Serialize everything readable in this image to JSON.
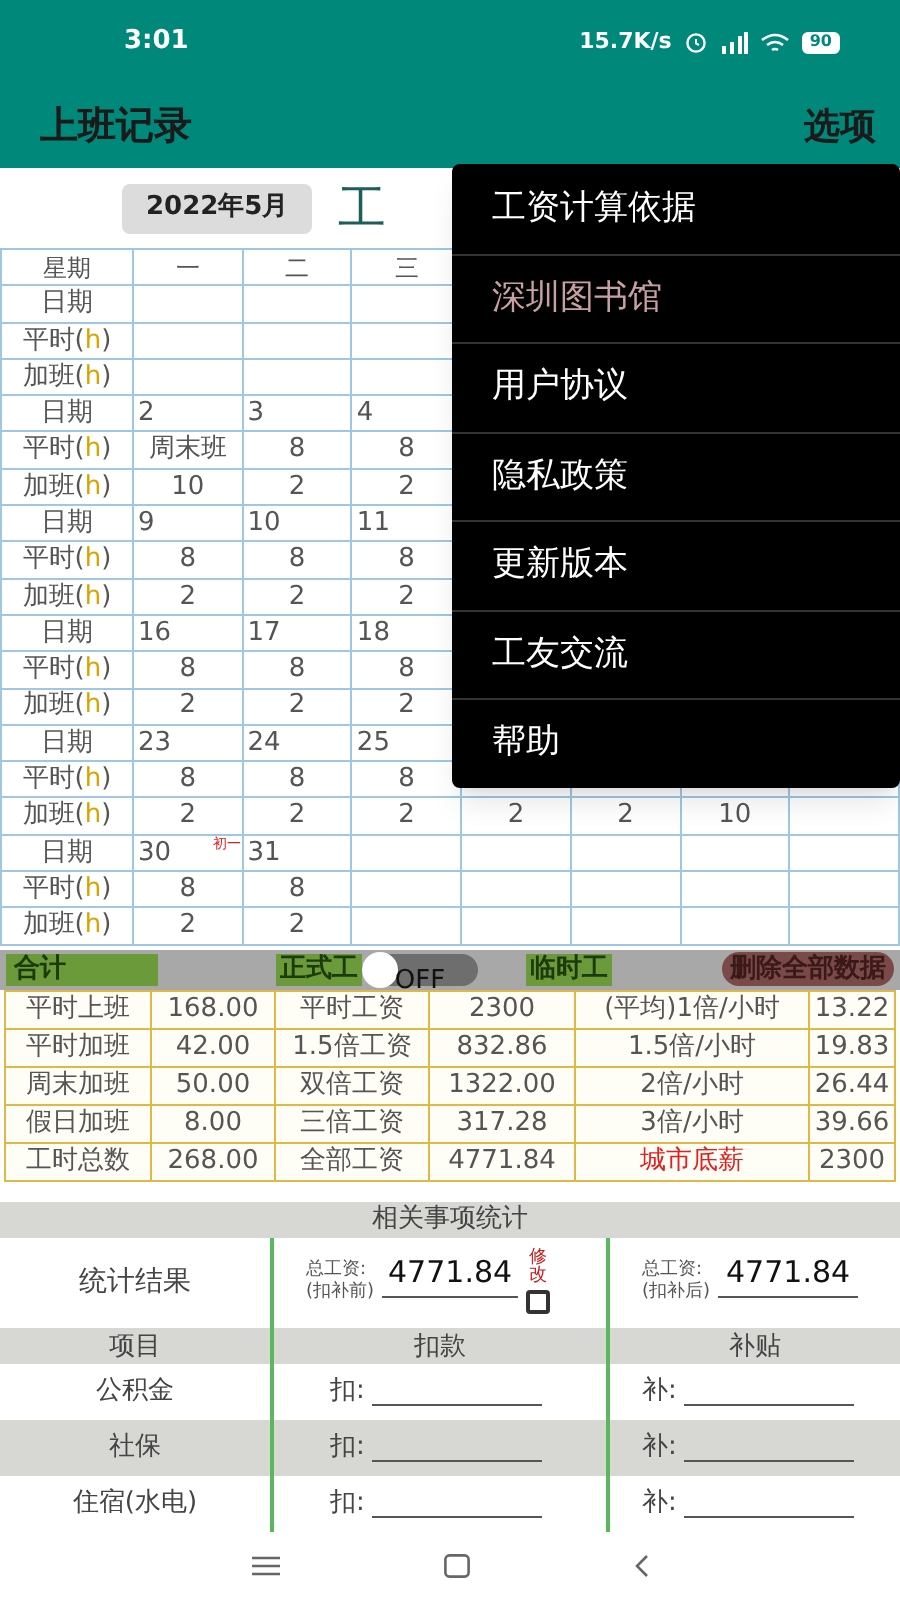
{
  "status_bar": {
    "time": "3:01",
    "speed": "15.7K/s",
    "battery": "90"
  },
  "app_bar": {
    "title": "上班记录",
    "menu_button": "选项"
  },
  "month_button": "2022年5月",
  "sheet_title": "工",
  "grid": {
    "header": {
      "label": "星期",
      "days": [
        "一",
        "二",
        "三"
      ]
    },
    "rows": [
      {
        "kind": "date",
        "label": "日期"
      },
      {
        "kind": "hours",
        "label": {
          "text": "平时(",
          "unit": "h",
          "close": ")"
        }
      },
      {
        "kind": "hours",
        "label": {
          "text": "加班(",
          "unit": "h",
          "close": ")"
        }
      },
      {
        "kind": "date",
        "label": "日期",
        "cells": [
          {
            "date": "2"
          },
          {
            "date": "3"
          },
          {
            "date": "4"
          }
        ]
      },
      {
        "kind": "hours",
        "label": {
          "text": "平时(",
          "unit": "h",
          "close": ")"
        },
        "cells": [
          "周末班",
          "8",
          "8"
        ]
      },
      {
        "kind": "hours",
        "label": {
          "text": "加班(",
          "unit": "h",
          "close": ")"
        },
        "cells": [
          "10",
          "2",
          "2"
        ]
      },
      {
        "kind": "date",
        "label": "日期",
        "cells": [
          {
            "date": "9"
          },
          {
            "date": "10"
          },
          {
            "date": "11"
          }
        ]
      },
      {
        "kind": "hours",
        "label": {
          "text": "平时(",
          "unit": "h",
          "close": ")"
        },
        "cells": [
          "8",
          "8",
          "8"
        ]
      },
      {
        "kind": "hours",
        "label": {
          "text": "加班(",
          "unit": "h",
          "close": ")"
        },
        "cells": [
          "2",
          "2",
          "2"
        ]
      },
      {
        "kind": "date",
        "label": "日期",
        "cells": [
          {
            "date": "16"
          },
          {
            "date": "17"
          },
          {
            "date": "18"
          }
        ]
      },
      {
        "kind": "hours",
        "label": {
          "text": "平时(",
          "unit": "h",
          "close": ")"
        },
        "cells": [
          "8",
          "8",
          "8"
        ]
      },
      {
        "kind": "hours",
        "label": {
          "text": "加班(",
          "unit": "h",
          "close": ")"
        },
        "cells": [
          "2",
          "2",
          "2"
        ]
      },
      {
        "kind": "date",
        "label": "日期",
        "cells": [
          {
            "date": "23"
          },
          {
            "date": "24"
          },
          {
            "date": "25"
          }
        ]
      },
      {
        "kind": "hours",
        "label": {
          "text": "平时(",
          "unit": "h",
          "close": ")"
        },
        "cells": [
          "8",
          "8",
          "8"
        ]
      },
      {
        "kind": "hours",
        "label": {
          "text": "加班(",
          "unit": "h",
          "close": ")"
        },
        "cells": [
          "2",
          "2",
          "2",
          "2",
          "2",
          "10"
        ]
      },
      {
        "kind": "date",
        "label": "日期",
        "cells": [
          {
            "date": "30",
            "lunar": "初一"
          },
          {
            "date": "31"
          }
        ]
      },
      {
        "kind": "hours",
        "label": {
          "text": "平时(",
          "unit": "h",
          "close": ")"
        },
        "cells": [
          "8",
          "8"
        ]
      },
      {
        "kind": "hours",
        "label": {
          "text": "加班(",
          "unit": "h",
          "close": ")"
        },
        "cells": [
          "2",
          "2"
        ]
      }
    ]
  },
  "totals_bar": {
    "total_label": "合计",
    "regular_label": "正式工",
    "toggle": {
      "on": false,
      "text": "OFF"
    },
    "temp_label": "临时工",
    "delete_button": "删除全部数据"
  },
  "summary": [
    {
      "cells": [
        "平时上班",
        "168.00",
        "平时工资",
        "2300",
        "(平均)1倍/小时",
        "13.22"
      ]
    },
    {
      "cells": [
        "平时加班",
        "42.00",
        "1.5倍工资",
        "832.86",
        "1.5倍/小时",
        "19.83"
      ]
    },
    {
      "cells": [
        "周末加班",
        "50.00",
        "双倍工资",
        "1322.00",
        "2倍/小时",
        "26.44"
      ]
    },
    {
      "cells": [
        "假日加班",
        "8.00",
        "三倍工资",
        "317.28",
        "3倍/小时",
        "39.66"
      ]
    },
    {
      "cells": [
        "工时总数",
        "268.00",
        "全部工资",
        "4771.84",
        {
          "text": "城市底薪",
          "alert": true
        },
        "2300"
      ]
    }
  ],
  "stats": {
    "title": "相关事项统计",
    "result_label": "统计结果",
    "before": {
      "label": "总工资:",
      "note": "(扣补前)",
      "value": "4771.84"
    },
    "edit": {
      "label": "修改",
      "checked": false
    },
    "after": {
      "label": "总工资:",
      "note": "(扣补后)",
      "value": "4771.84"
    },
    "columns": [
      "项目",
      "扣款",
      "补贴"
    ],
    "items": [
      {
        "name": "公积金",
        "deduct_label": "扣:",
        "subsidy_label": "补:"
      },
      {
        "name": "社保",
        "deduct_label": "扣:",
        "subsidy_label": "补:"
      },
      {
        "name": "住宿(水电)",
        "deduct_label": "扣:",
        "subsidy_label": "补:"
      }
    ]
  },
  "menu": [
    {
      "label": "工资计算依据",
      "disabled": false
    },
    {
      "label": "深圳图书馆",
      "disabled": true
    },
    {
      "label": "用户协议",
      "disabled": false
    },
    {
      "label": "隐私政策",
      "disabled": false
    },
    {
      "label": "更新版本",
      "disabled": false
    },
    {
      "label": "工友交流",
      "disabled": false
    },
    {
      "label": "帮助",
      "disabled": false
    }
  ]
}
